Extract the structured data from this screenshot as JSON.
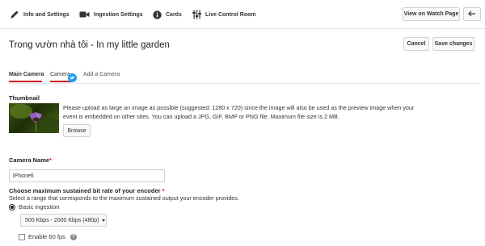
{
  "topbar": {
    "info": "Info and Settings",
    "ingestion": "Ingestion Settings",
    "cards": "Cards",
    "live": "Live Control Room",
    "watch": "View on Watch Page"
  },
  "page": {
    "title": "Trong vườn nhà tôi - In my little garden",
    "cancel": "Cancel",
    "save": "Save changes"
  },
  "tabs": [
    {
      "label": "Main Camera"
    },
    {
      "label": "Camera"
    },
    {
      "label": "Add a Camera"
    }
  ],
  "thumbnail": {
    "heading": "Thumbnail",
    "description": "Please upload as large an image as possible (suggested: 1280 x 720) since the image will also be used as the preview image when your event is embedded on other sites. You can upload a JPG, GIF, BMP or PNG file. Maximum file size is 2 MB.",
    "browse": "Browse"
  },
  "camera": {
    "heading": "Camera Name",
    "required_mark": "*",
    "value": "iPhone6"
  },
  "bitrate": {
    "heading": "Choose maximum sustained bit rate of your encoder",
    "required_mark": "*",
    "subtext": "Select a range that corresponds to the maximum sustained output your encoder provides.",
    "basic_label": "Basic ingestion",
    "selected_range": "500 Kbps - 2000 Kbps (480p)",
    "fps_label": "Enable 60 fps"
  },
  "colors": {
    "accent": "#cc181e",
    "twitter": "#1da1f2"
  },
  "icons": [
    "pencil-icon",
    "camera-icon",
    "info-icon",
    "sliders-icon",
    "back-arrow-icon",
    "twitter-bird-icon",
    "help-icon",
    "chevron-down-icon"
  ]
}
